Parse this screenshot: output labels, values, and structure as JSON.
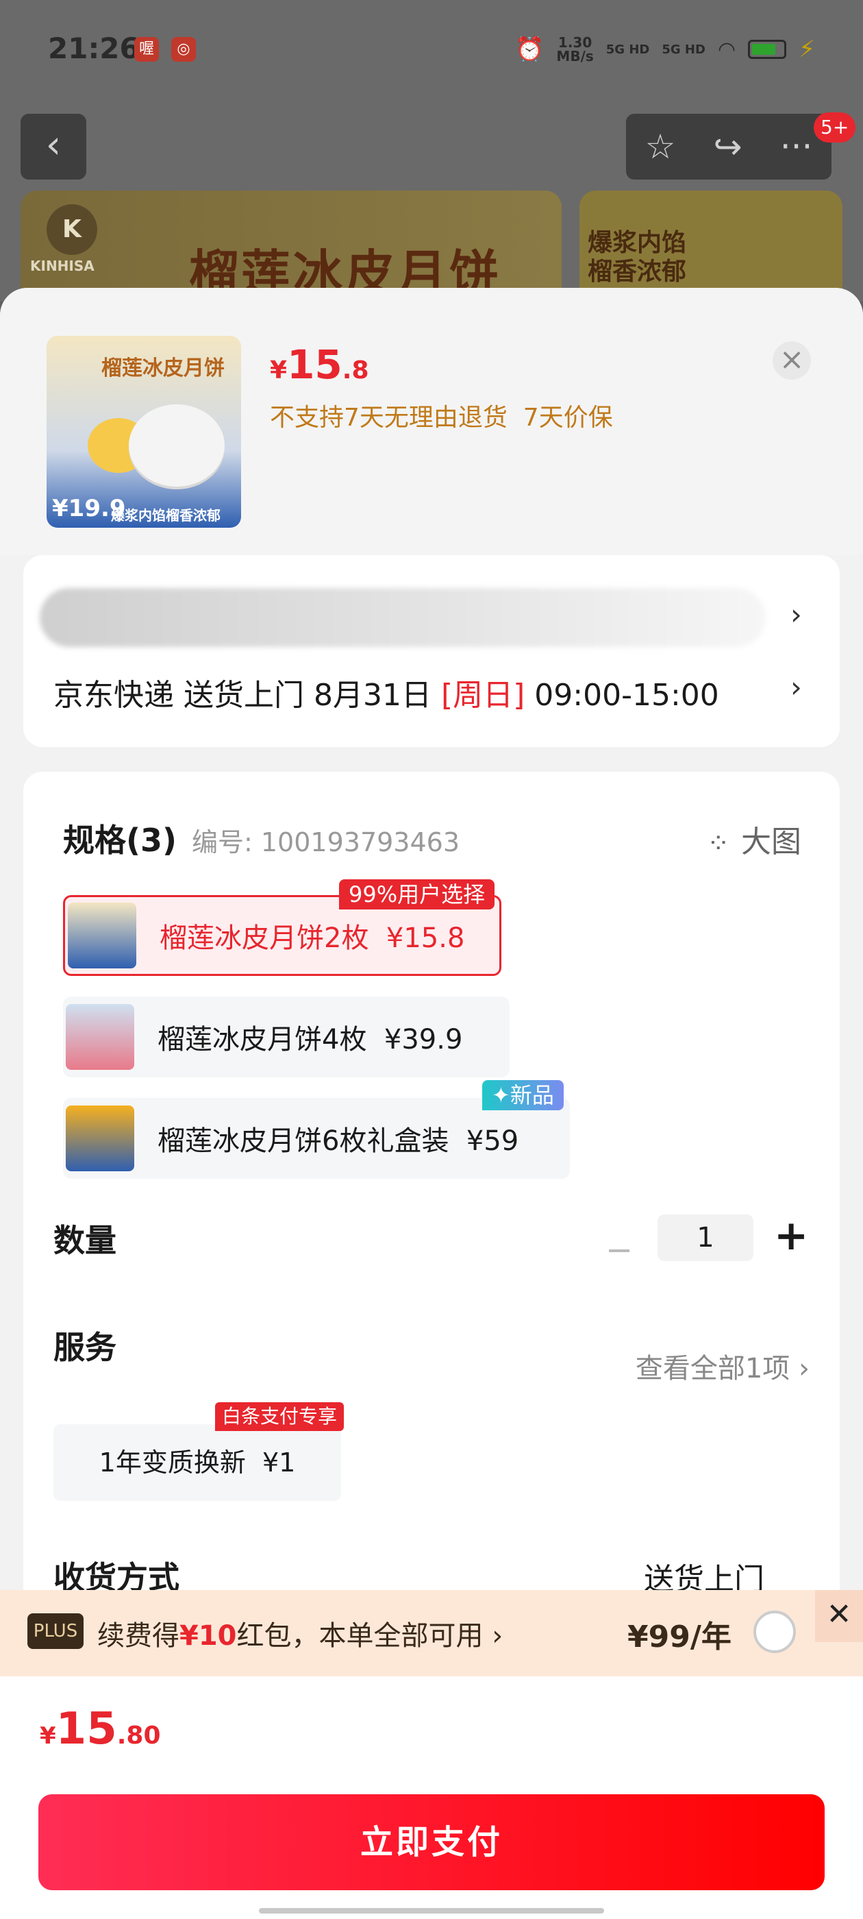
{
  "status_bar": {
    "time": "21:26",
    "app_badges": [
      "喔",
      "◎"
    ],
    "net_speed": "1.30\nMB/s",
    "signal_1": "5G HD",
    "signal_2": "5G HD"
  },
  "background": {
    "banner_brand": "KINHISA",
    "banner_title": "榴莲冰皮月饼",
    "banner_right_text": "爆浆内馅\n榴香浓郁",
    "nav_badge": "5+"
  },
  "product": {
    "thumb_title": "榴莲冰皮月饼",
    "thumb_price": "¥19.9",
    "thumb_tag": "爆浆内馅榴香浓郁",
    "price_yen": "¥",
    "price_int": "15",
    "price_dec": ".8",
    "policy": "不支持7天无理由退货  7天价保"
  },
  "delivery": {
    "text_pre": "京东快递 送货上门 8月31日 ",
    "day": "[周日]",
    "time": " 09:00-15:00"
  },
  "spec": {
    "title": "规格(3)",
    "code": "编号: 100193793463",
    "big_image": "大图",
    "options": [
      {
        "label": "榴莲冰皮月饼2枚  ¥15.8",
        "tag": "99%用户选择",
        "selected": true
      },
      {
        "label": "榴莲冰皮月饼4枚  ¥39.9",
        "tag": "",
        "selected": false
      },
      {
        "label": "榴莲冰皮月饼6枚礼盒装  ¥59",
        "tag": "✦新品",
        "selected": false
      }
    ]
  },
  "quantity": {
    "label": "数量",
    "value": "1",
    "minus": "−",
    "plus": "+"
  },
  "service": {
    "label": "服务",
    "view_all": "查看全部1项",
    "item": "1年变质换新  ¥1",
    "item_tag": "白条支付专享"
  },
  "receive": {
    "label": "收货方式",
    "value": "送货上门"
  },
  "promo": {
    "badge": "PLUS",
    "text_pre": "续费得",
    "text_red": "¥10",
    "text_post": "红包，本单全部可用 ›",
    "price": "¥99/年",
    "close": "✕"
  },
  "footer": {
    "price_yen": "¥",
    "price_int": "15",
    "price_dec": ".80",
    "pay_label": "立即支付"
  },
  "colors": {
    "accent_red": "#e8262e",
    "policy_orange": "#c07a1a",
    "new_tag_teal": "#1fc8c8",
    "promo_bg": "#fde8d8"
  }
}
